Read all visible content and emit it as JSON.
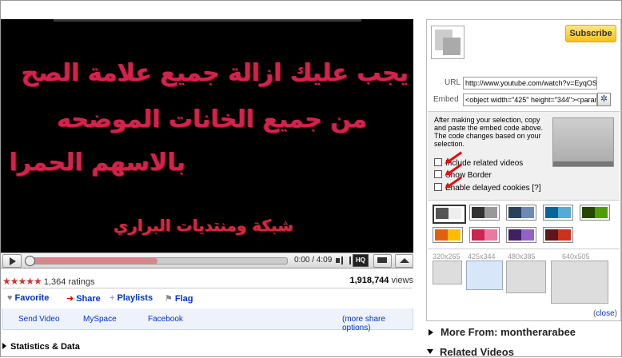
{
  "video": {
    "overlay_lines": [
      "يجب عليك ازالة جميع علامة الصح",
      "من جميع الخانات الموضحه",
      "بالاسهم الحمرا",
      "شبكة ومنتديات البراري"
    ],
    "overlay_color": "#d4234a"
  },
  "player": {
    "time": "0:00 / 4:09",
    "hq_label": "HQ",
    "progress": 0.5
  },
  "stats": {
    "rating_stars": "★★★★★",
    "ratings_label": "1,364 ratings",
    "views_number": "1,918,744",
    "views_label": "views"
  },
  "actions": {
    "favorite": "Favorite",
    "share": "Share",
    "playlists": "Playlists",
    "flag": "Flag"
  },
  "share_links": {
    "send_video": "Send Video",
    "myspace": "MySpace",
    "facebook": "Facebook",
    "more_options": "(more share options)"
  },
  "section": {
    "statistics": "Statistics & Data",
    "more_from": "More From: montherarabee",
    "related_videos": "Related Videos"
  },
  "panel": {
    "subscribe": "Subscribe",
    "url_label": "URL",
    "url_value": "http://www.youtube.com/watch?v=EyqOSy",
    "embed_label": "Embed",
    "embed_value": "<object width=\"425\" height=\"344\"><param",
    "hint": "After making your selection, copy and paste the embed code above. The code changes based on your selection.",
    "options": [
      "Include related videos",
      "Show Border",
      "Enable delayed cookies [?]"
    ],
    "sizes": [
      "320x265",
      "425x344",
      "480x385",
      "640x505"
    ],
    "close": "close"
  },
  "colors": {
    "accent": "#03c",
    "subscribe_bg": "#f8c01e",
    "swatches": [
      [
        "#555555",
        "#eeeeee"
      ],
      [
        "#333333",
        "#999999"
      ],
      [
        "#2b405b",
        "#6b8ab6"
      ],
      [
        "#006699",
        "#54abd6"
      ],
      [
        "#234900",
        "#4e9e00"
      ],
      [
        "#e1600f",
        "#febd01"
      ],
      [
        "#cc2550",
        "#e87a9f"
      ],
      [
        "#402061",
        "#9461ca"
      ],
      [
        "#5d1719",
        "#cd311b"
      ]
    ]
  }
}
